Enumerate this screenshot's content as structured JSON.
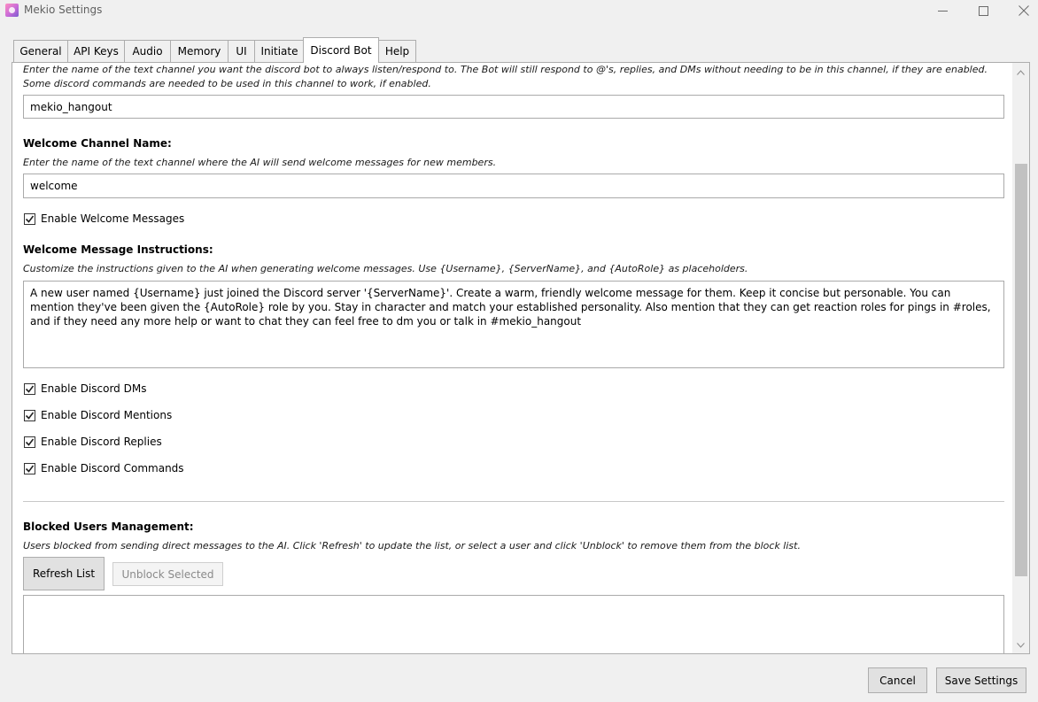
{
  "window": {
    "title": "Mekio Settings"
  },
  "tabs": [
    {
      "label": "General"
    },
    {
      "label": "API Keys"
    },
    {
      "label": "Audio"
    },
    {
      "label": "Memory"
    },
    {
      "label": "UI"
    },
    {
      "label": "Initiate"
    },
    {
      "label": "Discord Bot",
      "active": true
    },
    {
      "label": "Help"
    }
  ],
  "listen_channel": {
    "description": "Enter the name of the text channel you want the discord bot to always listen/respond to. The Bot will still respond to @'s, replies, and DMs without needing to be in this channel, if they are enabled. Some discord commands are needed to be used in this channel to work, if enabled.",
    "value": "mekio_hangout"
  },
  "welcome_channel": {
    "label": "Welcome Channel Name:",
    "description": "Enter the name of the text channel where the AI will send welcome messages for new members.",
    "value": "welcome"
  },
  "enable_welcome": {
    "label": "Enable Welcome Messages",
    "checked": true
  },
  "welcome_instructions": {
    "label": "Welcome Message Instructions:",
    "description": "Customize the instructions given to the AI when generating welcome messages. Use {Username}, {ServerName}, and {AutoRole} as placeholders.",
    "value": "A new user named {Username} just joined the Discord server '{ServerName}'. Create a warm, friendly welcome message for them. Keep it concise but personable. You can mention they've been given the {AutoRole} role by you. Stay in character and match your established personality. Also mention that they can get reaction roles for pings in #roles, and if they need any more help or want to chat they can feel free to dm you or talk in #mekio_hangout"
  },
  "options": [
    {
      "label": "Enable Discord DMs",
      "checked": true
    },
    {
      "label": "Enable Discord Mentions",
      "checked": true
    },
    {
      "label": "Enable Discord Replies",
      "checked": true
    },
    {
      "label": "Enable Discord Commands",
      "checked": true
    }
  ],
  "blocked_users": {
    "label": "Blocked Users Management:",
    "description": "Users blocked from sending direct messages to the AI. Click 'Refresh' to update the list, or select a user and click 'Unblock' to remove them from the block list.",
    "refresh_label": "Refresh List",
    "unblock_label": "Unblock Selected"
  },
  "footer": {
    "cancel_label": "Cancel",
    "save_label": "Save Settings"
  }
}
